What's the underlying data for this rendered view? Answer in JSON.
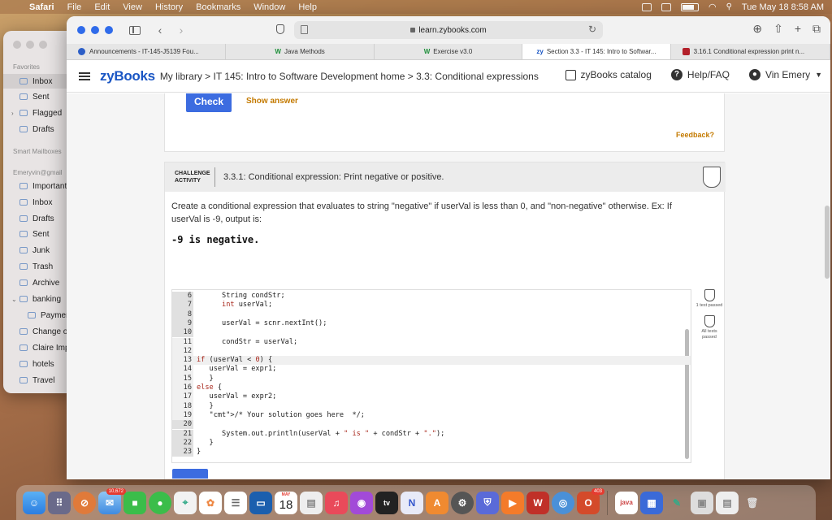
{
  "menubar": {
    "app": "Safari",
    "items": [
      "File",
      "Edit",
      "View",
      "History",
      "Bookmarks",
      "Window",
      "Help"
    ],
    "datetime": "Tue May 18  8:58 AM"
  },
  "mail": {
    "favorites_header": "Favorites",
    "favorites": [
      "Inbox",
      "Sent",
      "Flagged",
      "Drafts"
    ],
    "smart_header": "Smart Mailboxes",
    "account_header": "Emeryvin@gmail",
    "account_items": [
      "Important",
      "Inbox",
      "Drafts",
      "Sent",
      "Junk",
      "Trash",
      "Archive",
      "banking",
      "Paymen",
      "Change o",
      "Claire Imp",
      "hotels",
      "Travel"
    ]
  },
  "browser": {
    "url": "learn.zybooks.com",
    "tabs": [
      {
        "label": "Announcements - IT-145-J5139 Fou...",
        "color": "#2c5ec7"
      },
      {
        "label": "Java Methods",
        "color": "#1e8f3a"
      },
      {
        "label": "Exercise v3.0",
        "color": "#1e8f3a"
      },
      {
        "label": "Section 3.3 - IT 145: Intro to Softwar...",
        "color": "#1a56c4"
      },
      {
        "label": "3.16.1 Conditional expression print n...",
        "color": "#b3202a"
      }
    ]
  },
  "zybooks": {
    "logo": "zyBooks",
    "breadcrumb": "My library > IT 145: Intro to Software Development home > 3.3: Conditional expressions",
    "catalog": "zyBooks catalog",
    "help": "Help/FAQ",
    "user": "Vin Emery",
    "check_label": "Check",
    "show_answer_label": "Show answer",
    "feedback_label": "Feedback?",
    "challenge": {
      "label_line1": "CHALLENGE",
      "label_line2": "ACTIVITY",
      "title": "3.3.1: Conditional expression: Print negative or positive.",
      "instructions": "Create a conditional expression that evaluates to string \"negative\" if userVal is less than 0, and \"non-negative\" otherwise. Ex: If userVal is -9, output is:",
      "example_output": "-9 is negative.",
      "status_1": "1 test passed",
      "status_2": "All tests passed"
    },
    "code_lines": [
      {
        "n": "6",
        "text": "      String condStr;",
        "ro": true
      },
      {
        "n": "7",
        "text": "      int userVal;",
        "ro": true
      },
      {
        "n": "8",
        "text": "",
        "ro": true
      },
      {
        "n": "9",
        "text": "      userVal = scnr.nextInt();",
        "ro": true
      },
      {
        "n": "10",
        "text": "",
        "ro": true
      },
      {
        "n": "11",
        "text": "      condStr = userVal;",
        "ro": false
      },
      {
        "n": "12",
        "text": "",
        "ro": false
      },
      {
        "n": "13",
        "text": "if (userVal < 0) {",
        "ro": false,
        "hl": true
      },
      {
        "n": "14",
        "text": "   userVal = expr1;",
        "ro": false
      },
      {
        "n": "15",
        "text": "   }",
        "ro": false
      },
      {
        "n": "16",
        "text": "else {",
        "ro": false
      },
      {
        "n": "17",
        "text": "   userVal = expr2;",
        "ro": false
      },
      {
        "n": "18",
        "text": "   }",
        "ro": false
      },
      {
        "n": "19",
        "text": "   /* Your solution goes here  */;",
        "ro": false
      },
      {
        "n": "20",
        "text": "",
        "ro": true
      },
      {
        "n": "21",
        "text": "      System.out.println(userVal + \" is \" + condStr + \".\");",
        "ro": true
      },
      {
        "n": "22",
        "text": "   }",
        "ro": true
      },
      {
        "n": "23",
        "text": "}",
        "ro": true
      }
    ]
  },
  "dock": {
    "mail_badge": "10,672",
    "calendar_month": "MAY",
    "calendar_day": "18",
    "office_badge": "403",
    "java_label": "java"
  }
}
